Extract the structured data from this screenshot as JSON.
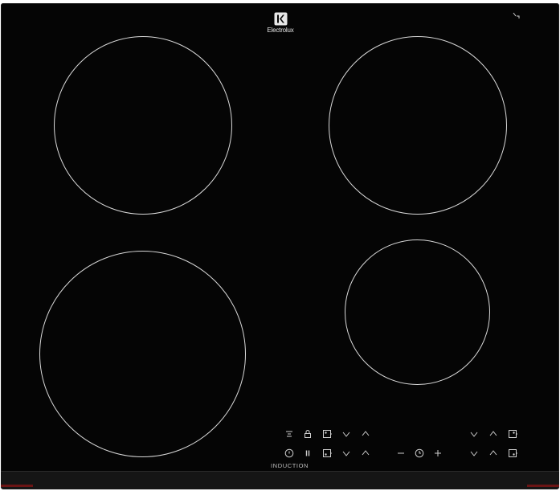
{
  "brand": {
    "name": "Electrolux",
    "logo_icon": "electrolux-logo-icon"
  },
  "panel": {
    "label": "INDUCTION",
    "corner_icon": "power-level-icon"
  },
  "colors": {
    "glass": "#050505",
    "markings": "#d9d9d9"
  },
  "cooking_zones": [
    {
      "name": "rear-left"
    },
    {
      "name": "rear-right"
    },
    {
      "name": "front-left"
    },
    {
      "name": "front-right"
    }
  ],
  "controls": {
    "row1": [
      "hob2hood-icon",
      "child-lock-icon",
      "zone-select-icon",
      "chevron-down-icon",
      "chevron-up-icon",
      "chevron-down-icon",
      "chevron-up-icon",
      "zone-select-icon"
    ],
    "row2": [
      "power-icon",
      "pause-icon",
      "zone-select-icon",
      "chevron-down-icon",
      "chevron-up-icon",
      "minus-icon",
      "timer-icon",
      "plus-icon",
      "chevron-down-icon",
      "chevron-up-icon",
      "zone-select-icon"
    ]
  }
}
